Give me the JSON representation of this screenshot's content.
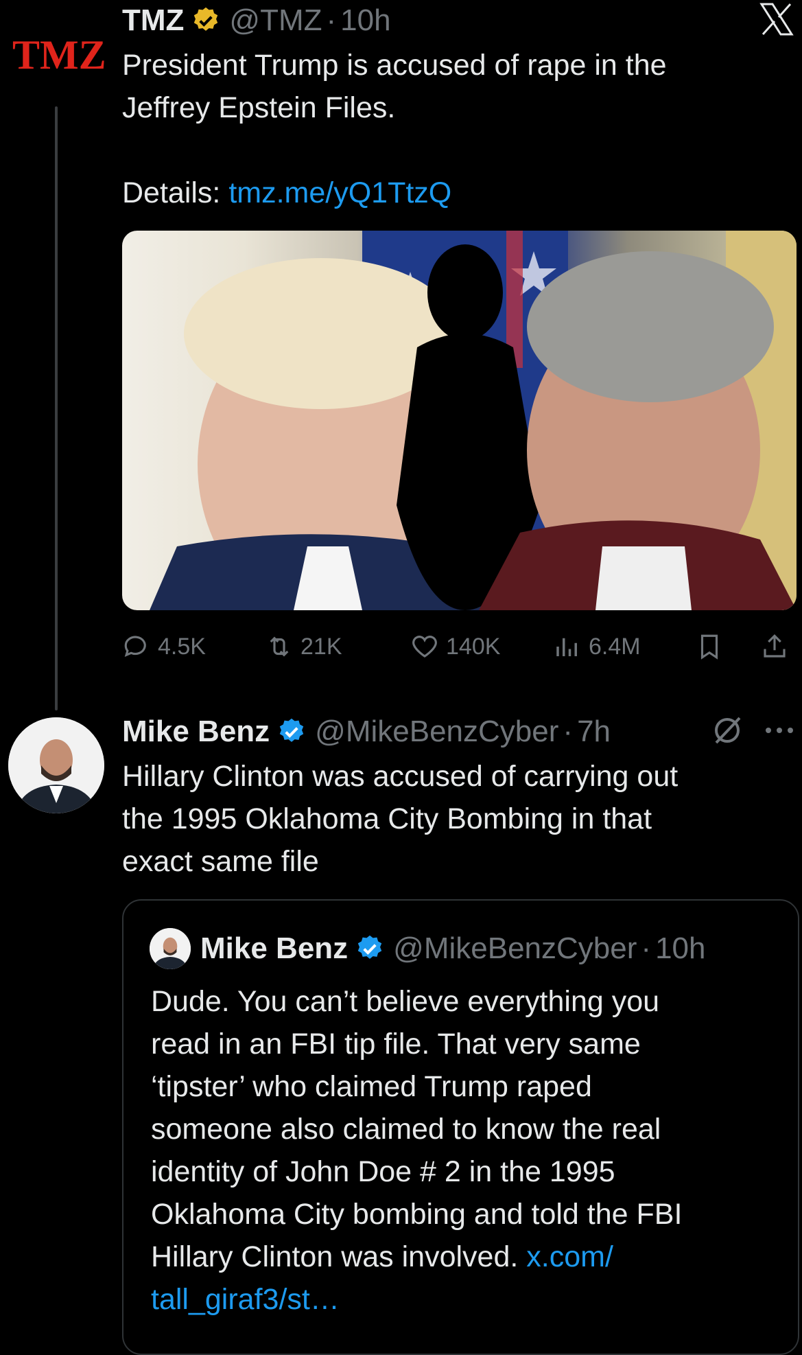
{
  "app": {
    "logo_icon": "x-logo-icon"
  },
  "original_tweet": {
    "avatar_text": "TMZ",
    "name": "TMZ",
    "verified_badge": "gold-verified-badge-icon",
    "handle": "@TMZ",
    "sep": "·",
    "time": "10h",
    "text_line1": "President Trump is accused of rape in the",
    "text_line2": "Jeffrey Epstein Files.",
    "details_label": "Details: ",
    "details_link": "tmz.me/yQ1TtzQ",
    "media_icon": "photo-trump-silhouette-epstein",
    "actions": {
      "replies": "4.5K",
      "reposts": "21K",
      "likes": "140K",
      "views": "6.4M"
    }
  },
  "reply_tweet": {
    "name": "Mike Benz",
    "verified_badge": "blue-verified-badge-icon",
    "handle": "@MikeBenzCyber",
    "sep": "·",
    "time": "7h",
    "text_line1": "Hillary Clinton was accused of carrying out",
    "text_line2": "the 1995 Oklahoma City Bombing in that",
    "text_line3": "exact same file",
    "quote": {
      "name": "Mike Benz",
      "handle": "@MikeBenzCyber",
      "sep": "·",
      "time": "10h",
      "lines": [
        "Dude. You can’t believe everything you",
        "read in an FBI tip file. That very same",
        "‘tipster’ who claimed Trump raped",
        "someone also claimed to know the real",
        "identity of John Doe # 2 in the 1995",
        "Oklahoma City bombing and told the FBI"
      ],
      "last_line_text": "Hillary Clinton was involved. ",
      "link_part1": "x.com/",
      "link_part2": "tall_giraf3/st…"
    }
  },
  "colors": {
    "background": "#000000",
    "text": "#e7e9ea",
    "muted": "#71767b",
    "link": "#1d9bf0",
    "tmz_red": "#e0241b",
    "gold_badge": "#e8b829"
  }
}
